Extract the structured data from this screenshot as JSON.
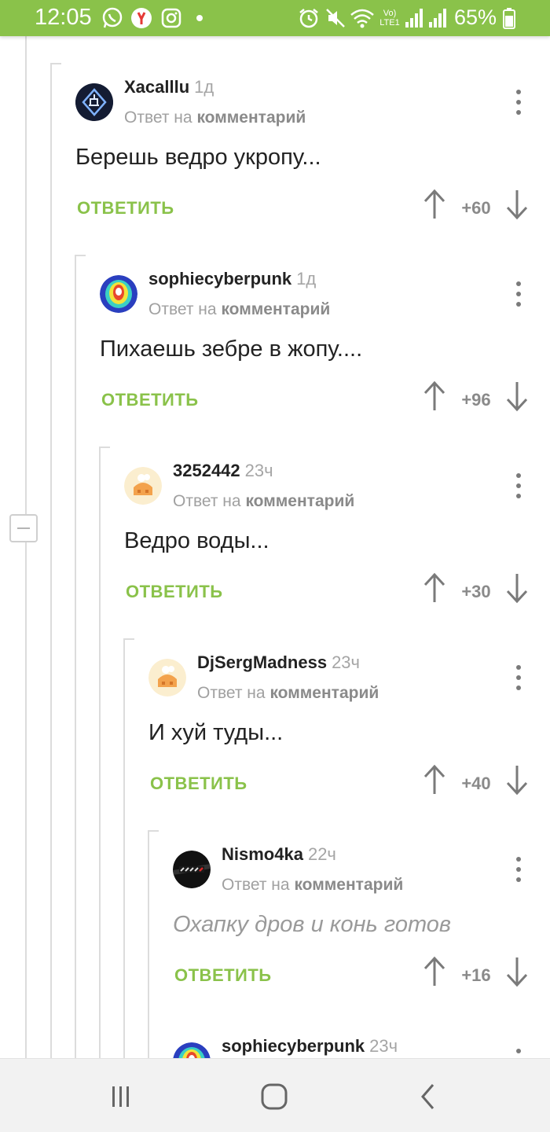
{
  "status_bar": {
    "time": "12:05",
    "battery": "65%",
    "lte_label_top": "Vo)",
    "lte_label_bottom": "LTE1",
    "left_icons": [
      "whatsapp-icon",
      "yandex-icon",
      "instagram-icon",
      "dot-icon"
    ],
    "right_icons": [
      "alarm-icon",
      "mute-icon",
      "wifi-icon",
      "lte-icon",
      "signal-icon",
      "signal-icon",
      "battery-icon"
    ],
    "colors": {
      "background": "#8ac24a",
      "foreground": "#ffffff"
    }
  },
  "labels": {
    "reply_prefix": "Ответ на",
    "reply_target": "комментарий",
    "reply_button": "ОТВЕТИТЬ"
  },
  "comments": [
    {
      "author": "Xacalllu",
      "age": "1д",
      "text": "Берешь ведро укропу...",
      "score": "+60",
      "avatar": "dynamo-logo-avatar"
    },
    {
      "author": "sophiecyberpunk",
      "age": "1д",
      "text": "Пихаешь зебре в жопу....",
      "score": "+96",
      "avatar": "thermal-image-avatar"
    },
    {
      "author": "3252442",
      "age": "23ч",
      "text": "Ведро воды...",
      "score": "+30",
      "avatar": "default-house-avatar"
    },
    {
      "author": "DjSergMadness",
      "age": "23ч",
      "text": "И хуй туды...",
      "score": "+40",
      "avatar": "default-house-avatar"
    },
    {
      "author": "Nismo4ka",
      "age": "22ч",
      "text": "Охапку дров и конь готов",
      "score": "+16",
      "avatar": "nismo-logo-avatar"
    },
    {
      "author": "sophiecyberpunk",
      "age": "23ч",
      "avatar": "thermal-image-avatar"
    }
  ],
  "colors": {
    "accent": "#8ac24a",
    "muted": "#a0a0a0",
    "text": "#222222"
  },
  "nav_bar": {
    "icons": [
      "recent-apps-icon",
      "home-icon",
      "back-icon"
    ]
  }
}
